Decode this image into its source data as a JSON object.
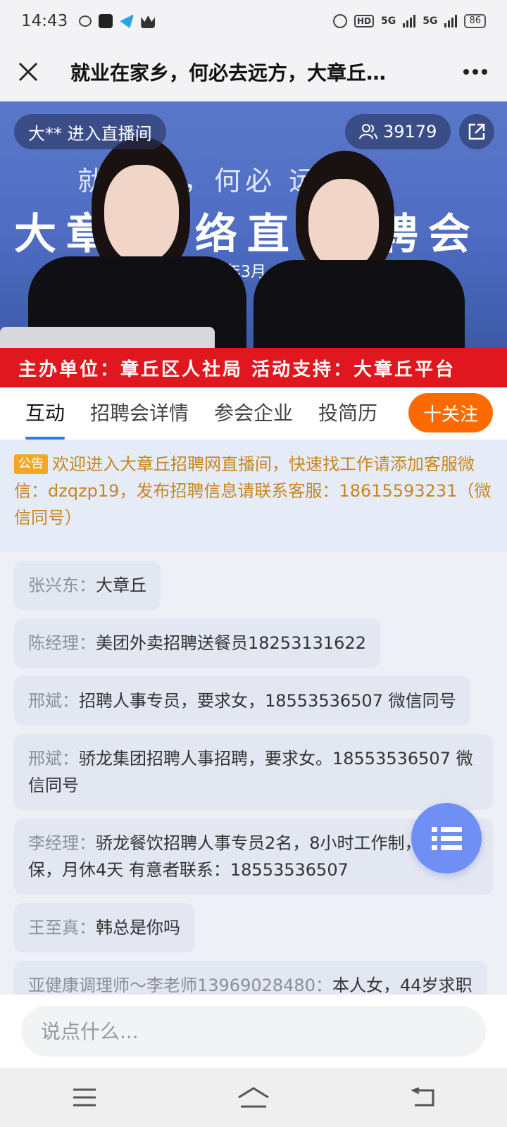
{
  "status_bar": {
    "time": "14:43",
    "network_1": "5G",
    "network_2": "5G",
    "hd_label": "HD",
    "battery": "86"
  },
  "header": {
    "title": "就业在家乡，何必去远方，大章丘…",
    "close_icon": "close-icon",
    "more_icon": "more-icon"
  },
  "video": {
    "bg_line1": "就  家乡，何必  远方",
    "bg_line2": "大章  网络直  招聘会",
    "bg_line3": "年3月",
    "enter_notice": "大** 进入直播间",
    "viewer_count": "39179",
    "share_icon": "share-icon"
  },
  "organizer_banner": "主办单位：章丘区人社局 活动支持：大章丘平台",
  "tabs": [
    {
      "label": "互动",
      "active": true
    },
    {
      "label": "招聘会详情",
      "active": false
    },
    {
      "label": "参会企业",
      "active": false
    },
    {
      "label": "投简历",
      "active": false
    }
  ],
  "follow_button": "十关注",
  "notice": {
    "badge": "公告",
    "text": "欢迎进入大章丘招聘网直播间，快速找工作请添加客服微信：dzqzp19，发布招聘信息请联系客服：18615593231（微信同号）"
  },
  "chat": [
    {
      "name": "张兴东：",
      "text": "大章丘"
    },
    {
      "name": "陈经理：",
      "text": "美团外卖招聘送餐员18253131622"
    },
    {
      "name": "邢斌：",
      "text": "招聘人事专员，要求女，18553536507 微信同号"
    },
    {
      "name": "邢斌：",
      "text": "骄龙集团招聘人事招聘，要求女。18553536507 微信同号"
    },
    {
      "name": "李经理：",
      "text": "骄龙餐饮招聘人事专员2名，8小时工作制，缴纳社保，月休4天 有意者联系：18553536507"
    },
    {
      "name": "王至真：",
      "text": "韩总是你吗"
    },
    {
      "name": "亚健康调理师～李老师13969028480：",
      "text": "本人女，44岁求职"
    }
  ],
  "input": {
    "placeholder": "说点什么..."
  },
  "colors": {
    "accent": "#ff6a00",
    "banner": "#e0171e",
    "tab_indicator": "#2a7de1",
    "notice_text": "#c8861e"
  }
}
